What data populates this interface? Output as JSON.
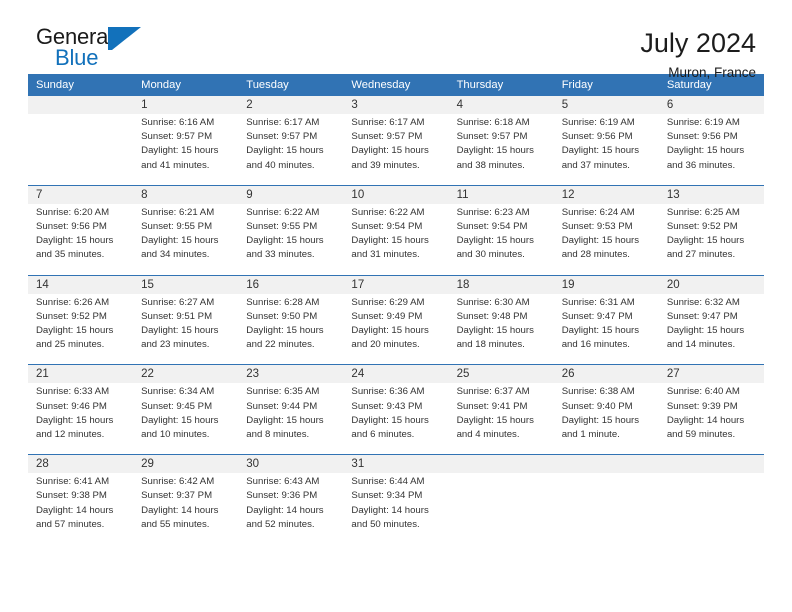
{
  "logo": {
    "word1": "General",
    "word2": "Blue",
    "mark_icon": "triangle-flag-icon",
    "brand_color": "#1271bb"
  },
  "header": {
    "title": "July 2024",
    "subtitle": "Muron, France"
  },
  "theme": {
    "header_blue": "#3173b4",
    "daynum_band": "#f1f1f1",
    "text": "#333333"
  },
  "calendar": {
    "weekday_headers": [
      "Sunday",
      "Monday",
      "Tuesday",
      "Wednesday",
      "Thursday",
      "Friday",
      "Saturday"
    ],
    "weeks": [
      [
        {
          "day": "",
          "sunrise": "",
          "sunset": "",
          "daylight_1": "",
          "daylight_2": ""
        },
        {
          "day": "1",
          "sunrise": "Sunrise: 6:16 AM",
          "sunset": "Sunset: 9:57 PM",
          "daylight_1": "Daylight: 15 hours",
          "daylight_2": "and 41 minutes."
        },
        {
          "day": "2",
          "sunrise": "Sunrise: 6:17 AM",
          "sunset": "Sunset: 9:57 PM",
          "daylight_1": "Daylight: 15 hours",
          "daylight_2": "and 40 minutes."
        },
        {
          "day": "3",
          "sunrise": "Sunrise: 6:17 AM",
          "sunset": "Sunset: 9:57 PM",
          "daylight_1": "Daylight: 15 hours",
          "daylight_2": "and 39 minutes."
        },
        {
          "day": "4",
          "sunrise": "Sunrise: 6:18 AM",
          "sunset": "Sunset: 9:57 PM",
          "daylight_1": "Daylight: 15 hours",
          "daylight_2": "and 38 minutes."
        },
        {
          "day": "5",
          "sunrise": "Sunrise: 6:19 AM",
          "sunset": "Sunset: 9:56 PM",
          "daylight_1": "Daylight: 15 hours",
          "daylight_2": "and 37 minutes."
        },
        {
          "day": "6",
          "sunrise": "Sunrise: 6:19 AM",
          "sunset": "Sunset: 9:56 PM",
          "daylight_1": "Daylight: 15 hours",
          "daylight_2": "and 36 minutes."
        }
      ],
      [
        {
          "day": "7",
          "sunrise": "Sunrise: 6:20 AM",
          "sunset": "Sunset: 9:56 PM",
          "daylight_1": "Daylight: 15 hours",
          "daylight_2": "and 35 minutes."
        },
        {
          "day": "8",
          "sunrise": "Sunrise: 6:21 AM",
          "sunset": "Sunset: 9:55 PM",
          "daylight_1": "Daylight: 15 hours",
          "daylight_2": "and 34 minutes."
        },
        {
          "day": "9",
          "sunrise": "Sunrise: 6:22 AM",
          "sunset": "Sunset: 9:55 PM",
          "daylight_1": "Daylight: 15 hours",
          "daylight_2": "and 33 minutes."
        },
        {
          "day": "10",
          "sunrise": "Sunrise: 6:22 AM",
          "sunset": "Sunset: 9:54 PM",
          "daylight_1": "Daylight: 15 hours",
          "daylight_2": "and 31 minutes."
        },
        {
          "day": "11",
          "sunrise": "Sunrise: 6:23 AM",
          "sunset": "Sunset: 9:54 PM",
          "daylight_1": "Daylight: 15 hours",
          "daylight_2": "and 30 minutes."
        },
        {
          "day": "12",
          "sunrise": "Sunrise: 6:24 AM",
          "sunset": "Sunset: 9:53 PM",
          "daylight_1": "Daylight: 15 hours",
          "daylight_2": "and 28 minutes."
        },
        {
          "day": "13",
          "sunrise": "Sunrise: 6:25 AM",
          "sunset": "Sunset: 9:52 PM",
          "daylight_1": "Daylight: 15 hours",
          "daylight_2": "and 27 minutes."
        }
      ],
      [
        {
          "day": "14",
          "sunrise": "Sunrise: 6:26 AM",
          "sunset": "Sunset: 9:52 PM",
          "daylight_1": "Daylight: 15 hours",
          "daylight_2": "and 25 minutes."
        },
        {
          "day": "15",
          "sunrise": "Sunrise: 6:27 AM",
          "sunset": "Sunset: 9:51 PM",
          "daylight_1": "Daylight: 15 hours",
          "daylight_2": "and 23 minutes."
        },
        {
          "day": "16",
          "sunrise": "Sunrise: 6:28 AM",
          "sunset": "Sunset: 9:50 PM",
          "daylight_1": "Daylight: 15 hours",
          "daylight_2": "and 22 minutes."
        },
        {
          "day": "17",
          "sunrise": "Sunrise: 6:29 AM",
          "sunset": "Sunset: 9:49 PM",
          "daylight_1": "Daylight: 15 hours",
          "daylight_2": "and 20 minutes."
        },
        {
          "day": "18",
          "sunrise": "Sunrise: 6:30 AM",
          "sunset": "Sunset: 9:48 PM",
          "daylight_1": "Daylight: 15 hours",
          "daylight_2": "and 18 minutes."
        },
        {
          "day": "19",
          "sunrise": "Sunrise: 6:31 AM",
          "sunset": "Sunset: 9:47 PM",
          "daylight_1": "Daylight: 15 hours",
          "daylight_2": "and 16 minutes."
        },
        {
          "day": "20",
          "sunrise": "Sunrise: 6:32 AM",
          "sunset": "Sunset: 9:47 PM",
          "daylight_1": "Daylight: 15 hours",
          "daylight_2": "and 14 minutes."
        }
      ],
      [
        {
          "day": "21",
          "sunrise": "Sunrise: 6:33 AM",
          "sunset": "Sunset: 9:46 PM",
          "daylight_1": "Daylight: 15 hours",
          "daylight_2": "and 12 minutes."
        },
        {
          "day": "22",
          "sunrise": "Sunrise: 6:34 AM",
          "sunset": "Sunset: 9:45 PM",
          "daylight_1": "Daylight: 15 hours",
          "daylight_2": "and 10 minutes."
        },
        {
          "day": "23",
          "sunrise": "Sunrise: 6:35 AM",
          "sunset": "Sunset: 9:44 PM",
          "daylight_1": "Daylight: 15 hours",
          "daylight_2": "and 8 minutes."
        },
        {
          "day": "24",
          "sunrise": "Sunrise: 6:36 AM",
          "sunset": "Sunset: 9:43 PM",
          "daylight_1": "Daylight: 15 hours",
          "daylight_2": "and 6 minutes."
        },
        {
          "day": "25",
          "sunrise": "Sunrise: 6:37 AM",
          "sunset": "Sunset: 9:41 PM",
          "daylight_1": "Daylight: 15 hours",
          "daylight_2": "and 4 minutes."
        },
        {
          "day": "26",
          "sunrise": "Sunrise: 6:38 AM",
          "sunset": "Sunset: 9:40 PM",
          "daylight_1": "Daylight: 15 hours",
          "daylight_2": "and 1 minute."
        },
        {
          "day": "27",
          "sunrise": "Sunrise: 6:40 AM",
          "sunset": "Sunset: 9:39 PM",
          "daylight_1": "Daylight: 14 hours",
          "daylight_2": "and 59 minutes."
        }
      ],
      [
        {
          "day": "28",
          "sunrise": "Sunrise: 6:41 AM",
          "sunset": "Sunset: 9:38 PM",
          "daylight_1": "Daylight: 14 hours",
          "daylight_2": "and 57 minutes."
        },
        {
          "day": "29",
          "sunrise": "Sunrise: 6:42 AM",
          "sunset": "Sunset: 9:37 PM",
          "daylight_1": "Daylight: 14 hours",
          "daylight_2": "and 55 minutes."
        },
        {
          "day": "30",
          "sunrise": "Sunrise: 6:43 AM",
          "sunset": "Sunset: 9:36 PM",
          "daylight_1": "Daylight: 14 hours",
          "daylight_2": "and 52 minutes."
        },
        {
          "day": "31",
          "sunrise": "Sunrise: 6:44 AM",
          "sunset": "Sunset: 9:34 PM",
          "daylight_1": "Daylight: 14 hours",
          "daylight_2": "and 50 minutes."
        },
        {
          "day": "",
          "sunrise": "",
          "sunset": "",
          "daylight_1": "",
          "daylight_2": ""
        },
        {
          "day": "",
          "sunrise": "",
          "sunset": "",
          "daylight_1": "",
          "daylight_2": ""
        },
        {
          "day": "",
          "sunrise": "",
          "sunset": "",
          "daylight_1": "",
          "daylight_2": ""
        }
      ]
    ]
  }
}
